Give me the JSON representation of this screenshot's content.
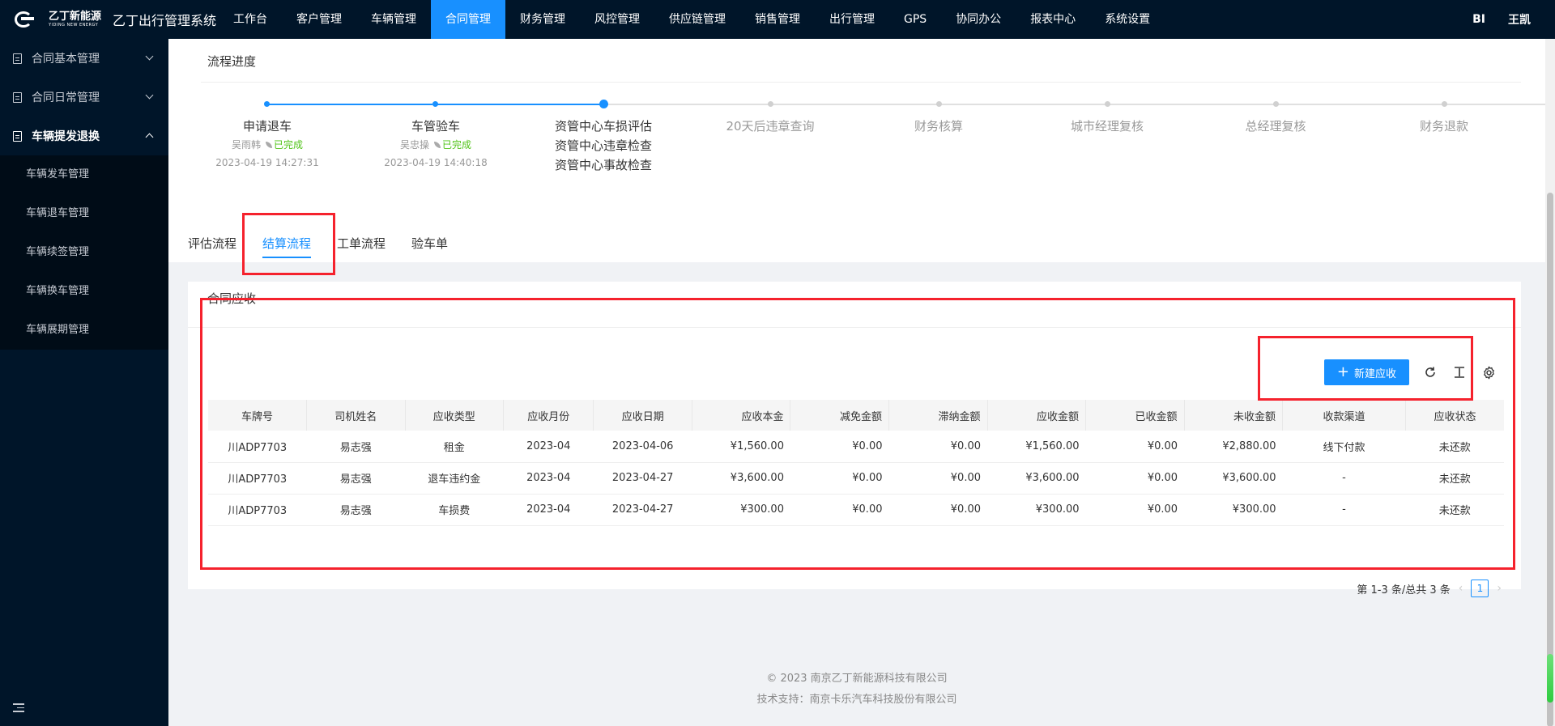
{
  "brand": {
    "logo_cn": "乙丁新能源",
    "logo_en": "YIDING NEW ENERGY",
    "app_title": "乙丁出行管理系统"
  },
  "nav": {
    "items": [
      "工作台",
      "客户管理",
      "车辆管理",
      "合同管理",
      "财务管理",
      "风控管理",
      "供应链管理",
      "销售管理",
      "出行管理",
      "GPS",
      "协同办公",
      "报表中心",
      "系统设置"
    ],
    "active_index": 3,
    "bi_label": "BI",
    "user_name": "王凯"
  },
  "sidebar": {
    "groups": [
      {
        "label": "合同基本管理"
      },
      {
        "label": "合同日常管理"
      },
      {
        "label": "车辆提发退换"
      }
    ],
    "sub_items": [
      "车辆发车管理",
      "车辆退车管理",
      "车辆续签管理",
      "车辆换车管理",
      "车辆展期管理"
    ]
  },
  "progress": {
    "title": "流程进度",
    "steps": [
      {
        "title": "申请退车",
        "operator": "吴雨韩",
        "status": "已完成",
        "time": "2023-04-19 14:27:31"
      },
      {
        "title": "车管验车",
        "operator": "吴忠操",
        "status": "已完成",
        "time": "2023-04-19 14:40:18"
      },
      {
        "title_lines": [
          "资管中心车损评估",
          "资管中心违章检查",
          "资管中心事故检查"
        ]
      },
      {
        "title": "20天后违章查询"
      },
      {
        "title": "财务核算"
      },
      {
        "title": "城市经理复核"
      },
      {
        "title": "总经理复核"
      },
      {
        "title": "财务退款"
      }
    ]
  },
  "tabs": [
    "评估流程",
    "结算流程",
    "工单流程",
    "验车单"
  ],
  "receivable": {
    "title": "合同应收",
    "new_button": "新建应收",
    "columns": [
      "车牌号",
      "司机姓名",
      "应收类型",
      "应收月份",
      "应收日期",
      "应收本金",
      "减免金额",
      "滞纳金额",
      "应收金额",
      "已收金额",
      "未收金额",
      "收款渠道",
      "应收状态"
    ],
    "rows": [
      [
        "川ADP7703",
        "易志强",
        "租金",
        "2023-04",
        "2023-04-06",
        "¥1,560.00",
        "¥0.00",
        "¥0.00",
        "¥1,560.00",
        "¥0.00",
        "¥2,880.00",
        "线下付款",
        "未还款"
      ],
      [
        "川ADP7703",
        "易志强",
        "退车违约金",
        "2023-04",
        "2023-04-27",
        "¥3,600.00",
        "¥0.00",
        "¥0.00",
        "¥3,600.00",
        "¥0.00",
        "¥3,600.00",
        "-",
        "未还款"
      ],
      [
        "川ADP7703",
        "易志强",
        "车损费",
        "2023-04",
        "2023-04-27",
        "¥300.00",
        "¥0.00",
        "¥0.00",
        "¥300.00",
        "¥0.00",
        "¥300.00",
        "-",
        "未还款"
      ]
    ],
    "pagination": {
      "summary": "第 1-3 条/总共 3 条",
      "current_page": "1"
    }
  },
  "footer": {
    "copyright": "© 2023 南京乙丁新能源科技有限公司",
    "support": "技术支持：南京卡乐汽车科技股份有限公司"
  },
  "colors": {
    "nav_bg": "#001529",
    "accent": "#1890ff",
    "success": "#52c41a",
    "highlight": "#f5222d"
  }
}
